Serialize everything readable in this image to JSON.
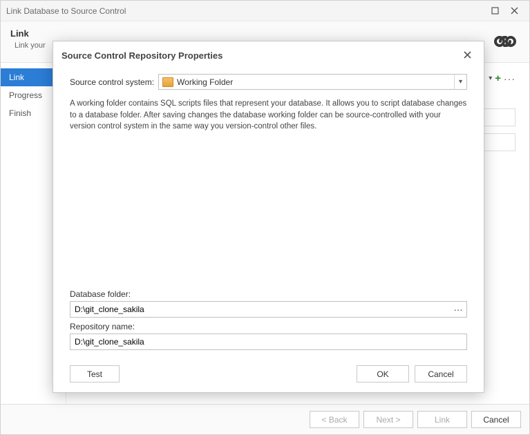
{
  "window": {
    "title": "Link Database to Source Control"
  },
  "header": {
    "title": "Link",
    "subtitle": "Link your"
  },
  "sidebar": {
    "items": [
      {
        "label": "Link",
        "active": true
      },
      {
        "label": "Progress",
        "active": false
      },
      {
        "label": "Finish",
        "active": false
      }
    ]
  },
  "footer": {
    "back": "< Back",
    "next": "Next >",
    "link": "Link",
    "cancel": "Cancel"
  },
  "modal": {
    "title": "Source Control Repository Properties",
    "scs_label": "Source control system:",
    "scs_value": "Working Folder",
    "description": "A working folder contains SQL scripts files that represent your database. It allows you to script database changes to a database folder. After saving changes the database working folder can be source-controlled with your version control system in the same way you version-control other files.",
    "db_folder_label": "Database folder:",
    "db_folder_value": "D:\\git_clone_sakila",
    "repo_name_label": "Repository name:",
    "repo_name_value": "D:\\git_clone_sakila",
    "test": "Test",
    "ok": "OK",
    "cancel": "Cancel"
  }
}
